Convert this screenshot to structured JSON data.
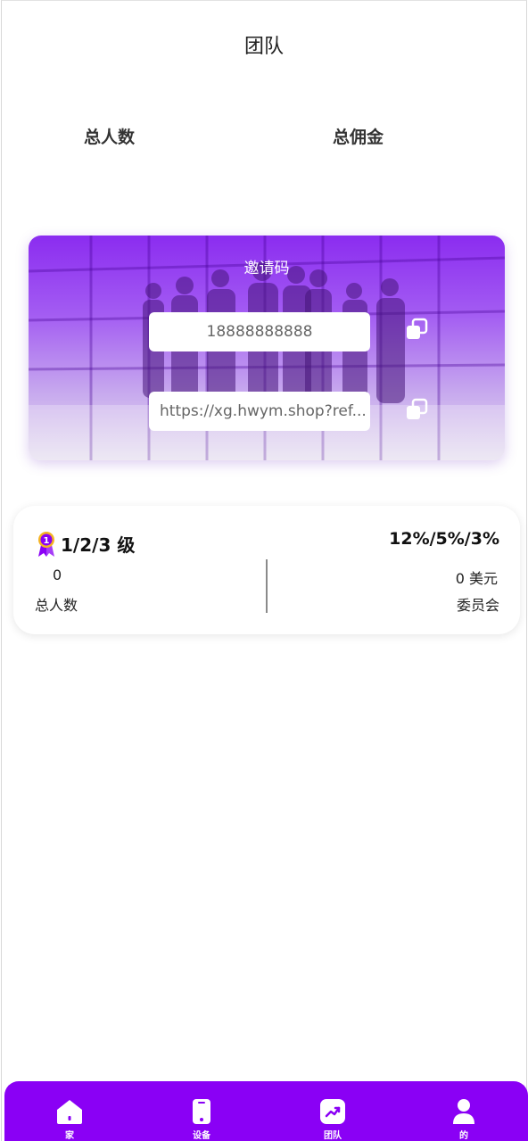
{
  "header": {
    "title": "团队"
  },
  "stats": {
    "total_people_label": "总人数",
    "total_commission_label": "总佣金"
  },
  "invite": {
    "title": "邀请码",
    "code": "18888888888",
    "link": "https://xg.hwym.shop?ref..."
  },
  "level": {
    "title": "1/2/3 级",
    "rates": "12%/5%/3%",
    "people_count": "0",
    "people_label": "总人数",
    "amount": "0 美元",
    "amount_label": "委员会"
  },
  "tabbar": {
    "items": [
      {
        "label": "家",
        "icon": "home-icon"
      },
      {
        "label": "设备",
        "icon": "phone-icon"
      },
      {
        "label": "团队",
        "icon": "chart-icon"
      },
      {
        "label": "的",
        "icon": "user-icon"
      }
    ]
  },
  "colors": {
    "accent": "#8a00f5",
    "card_gradient_top": "#8b2cf0"
  }
}
